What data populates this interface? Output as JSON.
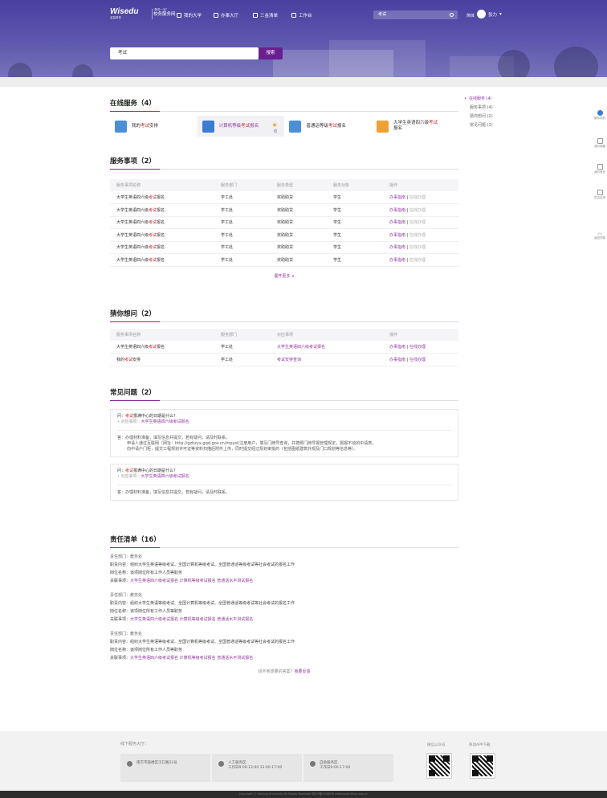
{
  "header": {
    "logo": "Wisedu",
    "logo_sub": "金智教育",
    "site_tagline": "\"服务一站\"",
    "site_name": "校务服务网",
    "nav": [
      {
        "label": "我的大学",
        "icon": "building-icon"
      },
      {
        "label": "办事大厅",
        "icon": "hall-icon"
      },
      {
        "label": "三金清单",
        "icon": "list-icon"
      },
      {
        "label": "工作台",
        "icon": "desk-icon"
      }
    ],
    "search_value": "考试",
    "lang": "简体",
    "user": "张力"
  },
  "banner": {
    "search_value": "考试",
    "search_button": "搜索"
  },
  "online_services": {
    "title": "在线服务（4）",
    "items": [
      {
        "pre": "我的",
        "hl": "考试",
        "post": "安排",
        "color": "#4a90d9"
      },
      {
        "pre": "计算机等级",
        "hl": "考试",
        "post": "报名",
        "color": "#3a7bd5"
      },
      {
        "pre": "普通话等级",
        "hl": "考试",
        "post": "报名",
        "color": "#4a90d9"
      },
      {
        "pre": "大学生英语四六级",
        "hl": "考试",
        "post": "报名",
        "color": "#f0a030"
      }
    ],
    "fav": "★",
    "edit": "收"
  },
  "service_items": {
    "title": "服务事项（2）",
    "headers": [
      "服务事项名称",
      "服务部门",
      "服务类型",
      "服务对象",
      "操作"
    ],
    "rows": [
      {
        "pre": "大学生英语四六级",
        "hl": "考试",
        "post": "报名",
        "dept": "学工处",
        "type": "奖助助贷",
        "target": "学生",
        "op1": "办事指南",
        "op2": "在线办理"
      },
      {
        "pre": "大学生英语四六级",
        "hl": "考试",
        "post": "报名",
        "dept": "学工处",
        "type": "奖助助贷",
        "target": "学生",
        "op1": "办事指南",
        "op2": "在线办理"
      },
      {
        "pre": "大学生英语四六级",
        "hl": "考试",
        "post": "报名",
        "dept": "学工处",
        "type": "奖助助贷",
        "target": "学生",
        "op1": "办事指南",
        "op2": "在线办理"
      },
      {
        "pre": "大学生英语四六级",
        "hl": "考试",
        "post": "报名",
        "dept": "学工处",
        "type": "奖助助贷",
        "target": "学生",
        "op1": "办事指南",
        "op2": "在线办理"
      },
      {
        "pre": "大学生英语四六级",
        "hl": "考试",
        "post": "报名",
        "dept": "学工处",
        "type": "奖助助贷",
        "target": "学生",
        "op1": "办事指南",
        "op2": "在线办理"
      },
      {
        "pre": "大学生英语四六级",
        "hl": "考试",
        "post": "报名",
        "dept": "学工处",
        "type": "奖助助贷",
        "target": "学生",
        "op1": "办事指南",
        "op2": "在线办理"
      }
    ],
    "more": "展开更多 ∨"
  },
  "guess": {
    "title": "猜你想问（2）",
    "headers": [
      "服务事项名称",
      "服务部门",
      "对应事项",
      "操作"
    ],
    "rows": [
      {
        "pre": "大学生英语四六级",
        "hl": "考试",
        "post": "报名",
        "dept": "学工处",
        "rel": "大学生英语四六级考试报名",
        "op1": "办事指南",
        "op2": "在线办理"
      },
      {
        "pre": "我的",
        "hl": "考试",
        "post": "安排",
        "dept": "学工处",
        "rel": "考试安排查询",
        "op1": "办事指南",
        "op2": "在线办理"
      }
    ]
  },
  "faq": {
    "title": "常见问题（2）",
    "items": [
      {
        "q_pre": "问：",
        "q_hl": "考试",
        "q_post": "报满中心的日期是什么？",
        "rel_pre": "• 对应事项：",
        "rel_link": "大学生英语四六级考试报名",
        "a1": "答：办理材料准备，填写信息并提交，若有疑问，请及时联系。",
        "a2": "申请人通过互联网（网址：http://gzhzyx.gqd.gov.cn/mpysl/注册用户，填写门牌号查询，并按照门牌号报管理规定，报报不动的中请表，",
        "a3": "向中请户门柜，提交工程规划许可证等资料扫描后附件上传，同时提交经过规划审批的（包括图纸建筑外观及门口规划等信息等）。"
      },
      {
        "q_pre": "问：",
        "q_hl": "考试",
        "q_post": "报满中心的日期是什么？",
        "rel_pre": "• 对应事项：",
        "rel_link": "大学生英语四六级考试报名",
        "a1": "答：办理材料准备，填写信息并提交，若有疑问，请及时联系。"
      }
    ]
  },
  "responsibility": {
    "title": "责任清单（16）",
    "blocks": [
      {
        "dept": "责任部门：教务处",
        "content": "职责内容：组织大学生英语等级考试、全国计算机等级考试、全国普通话等级考试等社会考试的报名工作",
        "post": "岗位名称：该项岗位所有工作人员等职务",
        "links_label": "关联事项：",
        "links": [
          "大学生英语四六级考试报名",
          "计算机等级考试报名",
          "普通话水平测试报名"
        ]
      },
      {
        "dept": "责任部门：教务处",
        "content": "职责内容：组织大学生英语等级考试、全国计算机等级考试、全国普通话等级考试等社会考试的报名工作",
        "post": "岗位名称：该项岗位所有工作人员等职务",
        "links_label": "关联事项：",
        "links": [
          "大学生英语四六级考试报名",
          "计算机等级考试报名",
          "普通话水平测试报名"
        ]
      },
      {
        "dept": "责任部门：教务处",
        "content": "职责内容：组织大学生英语等级考试、全国计算机等级考试、全国普通话等级考试等社会考试的报名工作",
        "post": "岗位名称：该项岗位所有工作人员等职务",
        "links_label": "关联事项：",
        "links": [
          "大学生英语四六级考试报名",
          "计算机等级考试报名",
          "普通话水平测试报名"
        ]
      }
    ]
  },
  "feedback": {
    "pre": "找不到想要的答案？",
    "link": "我要反馈"
  },
  "sidenav": [
    {
      "label": "在线服务 (4)",
      "active": true
    },
    {
      "label": "服务事项 (4)"
    },
    {
      "label": "猜你想问 (2)"
    },
    {
      "label": "常见问题 (2)"
    }
  ],
  "righttools": [
    {
      "label": "服务导航",
      "icon": "eye-icon"
    },
    {
      "label": "我的收藏",
      "icon": "doc-icon"
    },
    {
      "label": "我的首页",
      "icon": "home-icon"
    },
    {
      "label": "意见反馈",
      "icon": "note-icon"
    },
    {
      "label": "返回顶部",
      "icon": "up-arrow-icon"
    }
  ],
  "footer": {
    "title": "线下服务大厅：",
    "boxes": [
      {
        "l1": "南京市鼓楼区汉口路22号",
        "l2": ""
      },
      {
        "l1": "人工服务区",
        "l2": "工作日9:00-12:00 13:00-17:00"
      },
      {
        "l1": "自助服务区",
        "l2": "工作日9:00-17:00"
      }
    ],
    "qr1": "微信公众号",
    "qr2": "移动APP下载",
    "copyright": "Copyright © Nanjing University All Rights Reserved 苏ICP备10085号 webmaster@nju.edu.cn"
  }
}
